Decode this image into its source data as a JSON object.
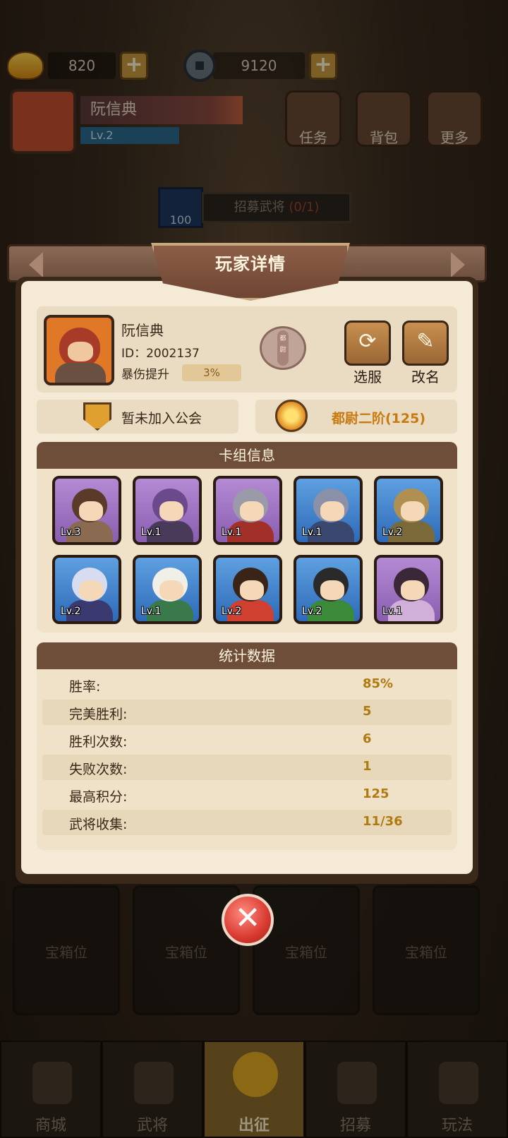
{
  "resources": {
    "gold": "820",
    "coins": "9120"
  },
  "player_card": {
    "name": "阮信典",
    "level": "Lv.2"
  },
  "top_buttons": [
    "任务",
    "背包",
    "更多"
  ],
  "recruit": {
    "cost": "100",
    "label": "招募武将",
    "count": "(0/1)"
  },
  "modal": {
    "title": "玩家详情",
    "player": {
      "name": "阮信典",
      "id": "ID：2002137",
      "crit_label": "暴伤提升",
      "crit_value": "3%",
      "rank_badge_text": "都尉"
    },
    "actions": {
      "server": "选服",
      "rename": "改名",
      "server_icon": "refresh-icon",
      "rename_icon": "pencil-icon"
    },
    "guild": "暂未加入公会",
    "rank": "都尉二阶(125)",
    "cards_title": "卡组信息",
    "cards": [
      {
        "level": "Lv.3",
        "rarity": "purple",
        "hair": "#5a3a28",
        "armor": "#8a6a50"
      },
      {
        "level": "Lv.1",
        "rarity": "purple",
        "hair": "#6a4a8a",
        "armor": "#4a3a5a"
      },
      {
        "level": "Lv.1",
        "rarity": "purple",
        "hair": "#9a9aa8",
        "armor": "#a03028"
      },
      {
        "level": "Lv.1",
        "rarity": "blue",
        "hair": "#8a90a8",
        "armor": "#3a4870"
      },
      {
        "level": "Lv.2",
        "rarity": "blue",
        "hair": "#b09050",
        "armor": "#7a6a3a"
      },
      {
        "level": "Lv.2",
        "rarity": "blue",
        "hair": "#d8dcf0",
        "armor": "#3a3a70"
      },
      {
        "level": "Lv.1",
        "rarity": "blue",
        "hair": "#f0f0e8",
        "armor": "#3a7a4a"
      },
      {
        "level": "Lv.2",
        "rarity": "blue",
        "hair": "#3a2418",
        "armor": "#d04030"
      },
      {
        "level": "Lv.2",
        "rarity": "blue",
        "hair": "#2a2a2a",
        "armor": "#3a8a3a"
      },
      {
        "level": "Lv.1",
        "rarity": "purple",
        "hair": "#3a2838",
        "armor": "#d0b0d8"
      }
    ],
    "stats_title": "统计数据",
    "stats": [
      {
        "label": "胜率:",
        "value": "85%"
      },
      {
        "label": "完美胜利:",
        "value": "5"
      },
      {
        "label": "胜利次数:",
        "value": "6"
      },
      {
        "label": "失败次数:",
        "value": "1"
      },
      {
        "label": "最高积分:",
        "value": "125"
      },
      {
        "label": "武将收集:",
        "value": "11/36"
      }
    ]
  },
  "chest_slots": [
    "宝箱位",
    "宝箱位",
    "宝箱位",
    "宝箱位"
  ],
  "bottom_nav": [
    {
      "label": "商城",
      "active": false
    },
    {
      "label": "武将",
      "active": false
    },
    {
      "label": "出征",
      "active": true
    },
    {
      "label": "招募",
      "active": false
    },
    {
      "label": "玩法",
      "active": false
    }
  ]
}
